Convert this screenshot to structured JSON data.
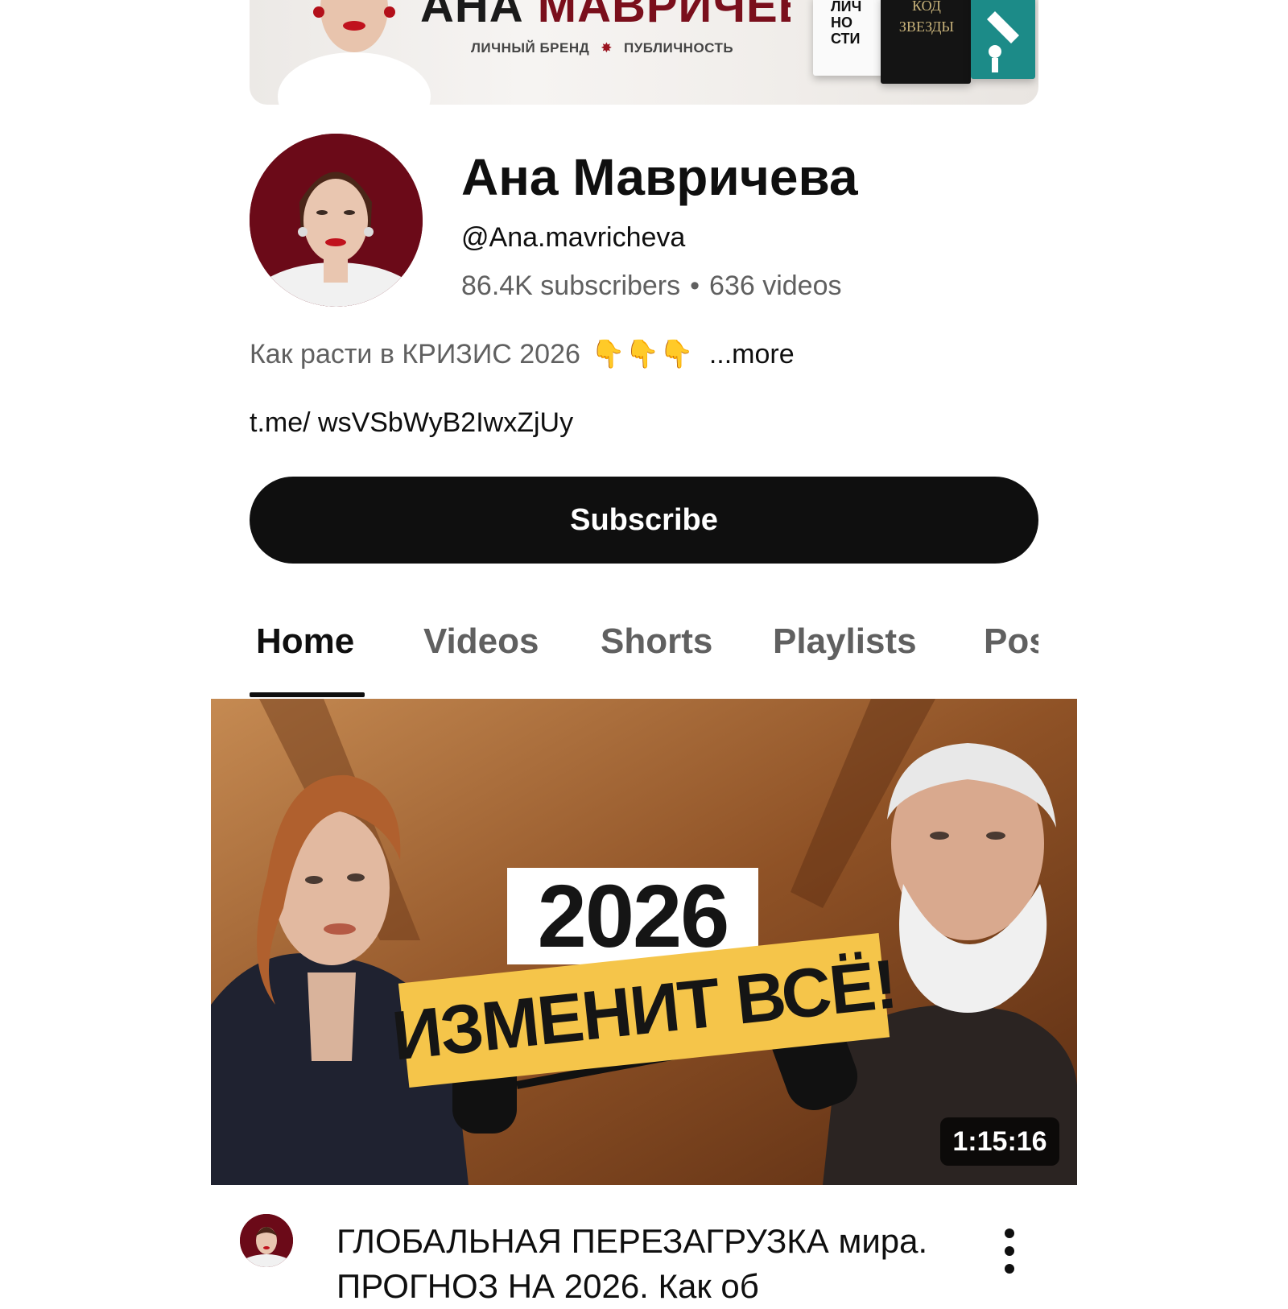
{
  "banner": {
    "title_part1": "АНА ",
    "title_part2": "МАВРИЧЕВА",
    "tag1": "ЛИЧНЫЙ БРЕНД",
    "tag2": "ПУБЛИЧНОСТЬ",
    "book1_text": "ЛИЧ\nНО\nСТИ",
    "book2_text": "КОД\nЗВЕЗДЫ"
  },
  "channel": {
    "name": "Ана Мавричева",
    "handle": "@Ana.mavricheva",
    "subscribers": "86.4K subscribers",
    "separator": "•",
    "videos": "636 videos",
    "description": "Как расти в КРИЗИС 2026",
    "description_emoji": "👇👇👇",
    "more_label": "...more",
    "link": "t.me/ wsVSbWyB2IwxZjUy",
    "subscribe_label": "Subscribe"
  },
  "tabs": [
    {
      "label": "Home",
      "active": true
    },
    {
      "label": "Videos",
      "active": false
    },
    {
      "label": "Shorts",
      "active": false
    },
    {
      "label": "Playlists",
      "active": false
    },
    {
      "label": "Pos",
      "active": false
    }
  ],
  "video": {
    "thumbnail_year": "2026",
    "thumbnail_headline": "ИЗМЕНИТ ВСЁ!",
    "duration": "1:15:16",
    "title": "ГЛОБАЛЬНАЯ ПЕРЕЗАГРУЗКА мира. ПРОГНОЗ НА 2026. Как об"
  },
  "icons": {
    "more_actions": "kebab-vertical-icon"
  },
  "colors": {
    "subscribe_bg": "#0f0f0f",
    "avatar_bg": "#6b0a18",
    "headline_band": "#f5c54a",
    "secondary_text": "#606060"
  }
}
